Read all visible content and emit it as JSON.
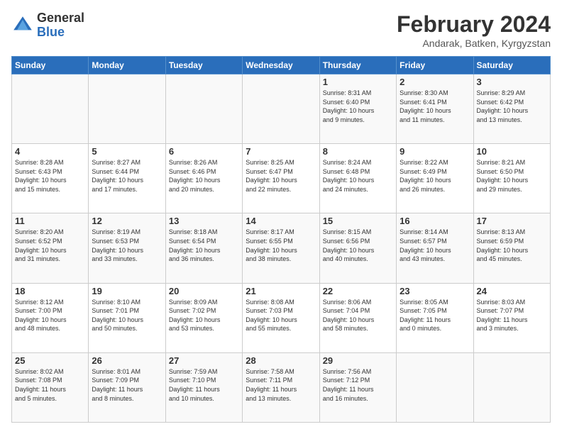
{
  "header": {
    "logo_general": "General",
    "logo_blue": "Blue",
    "month_year": "February 2024",
    "location": "Andarak, Batken, Kyrgyzstan"
  },
  "days_of_week": [
    "Sunday",
    "Monday",
    "Tuesday",
    "Wednesday",
    "Thursday",
    "Friday",
    "Saturday"
  ],
  "weeks": [
    [
      {
        "day": "",
        "info": ""
      },
      {
        "day": "",
        "info": ""
      },
      {
        "day": "",
        "info": ""
      },
      {
        "day": "",
        "info": ""
      },
      {
        "day": "1",
        "info": "Sunrise: 8:31 AM\nSunset: 6:40 PM\nDaylight: 10 hours\nand 9 minutes."
      },
      {
        "day": "2",
        "info": "Sunrise: 8:30 AM\nSunset: 6:41 PM\nDaylight: 10 hours\nand 11 minutes."
      },
      {
        "day": "3",
        "info": "Sunrise: 8:29 AM\nSunset: 6:42 PM\nDaylight: 10 hours\nand 13 minutes."
      }
    ],
    [
      {
        "day": "4",
        "info": "Sunrise: 8:28 AM\nSunset: 6:43 PM\nDaylight: 10 hours\nand 15 minutes."
      },
      {
        "day": "5",
        "info": "Sunrise: 8:27 AM\nSunset: 6:44 PM\nDaylight: 10 hours\nand 17 minutes."
      },
      {
        "day": "6",
        "info": "Sunrise: 8:26 AM\nSunset: 6:46 PM\nDaylight: 10 hours\nand 20 minutes."
      },
      {
        "day": "7",
        "info": "Sunrise: 8:25 AM\nSunset: 6:47 PM\nDaylight: 10 hours\nand 22 minutes."
      },
      {
        "day": "8",
        "info": "Sunrise: 8:24 AM\nSunset: 6:48 PM\nDaylight: 10 hours\nand 24 minutes."
      },
      {
        "day": "9",
        "info": "Sunrise: 8:22 AM\nSunset: 6:49 PM\nDaylight: 10 hours\nand 26 minutes."
      },
      {
        "day": "10",
        "info": "Sunrise: 8:21 AM\nSunset: 6:50 PM\nDaylight: 10 hours\nand 29 minutes."
      }
    ],
    [
      {
        "day": "11",
        "info": "Sunrise: 8:20 AM\nSunset: 6:52 PM\nDaylight: 10 hours\nand 31 minutes."
      },
      {
        "day": "12",
        "info": "Sunrise: 8:19 AM\nSunset: 6:53 PM\nDaylight: 10 hours\nand 33 minutes."
      },
      {
        "day": "13",
        "info": "Sunrise: 8:18 AM\nSunset: 6:54 PM\nDaylight: 10 hours\nand 36 minutes."
      },
      {
        "day": "14",
        "info": "Sunrise: 8:17 AM\nSunset: 6:55 PM\nDaylight: 10 hours\nand 38 minutes."
      },
      {
        "day": "15",
        "info": "Sunrise: 8:15 AM\nSunset: 6:56 PM\nDaylight: 10 hours\nand 40 minutes."
      },
      {
        "day": "16",
        "info": "Sunrise: 8:14 AM\nSunset: 6:57 PM\nDaylight: 10 hours\nand 43 minutes."
      },
      {
        "day": "17",
        "info": "Sunrise: 8:13 AM\nSunset: 6:59 PM\nDaylight: 10 hours\nand 45 minutes."
      }
    ],
    [
      {
        "day": "18",
        "info": "Sunrise: 8:12 AM\nSunset: 7:00 PM\nDaylight: 10 hours\nand 48 minutes."
      },
      {
        "day": "19",
        "info": "Sunrise: 8:10 AM\nSunset: 7:01 PM\nDaylight: 10 hours\nand 50 minutes."
      },
      {
        "day": "20",
        "info": "Sunrise: 8:09 AM\nSunset: 7:02 PM\nDaylight: 10 hours\nand 53 minutes."
      },
      {
        "day": "21",
        "info": "Sunrise: 8:08 AM\nSunset: 7:03 PM\nDaylight: 10 hours\nand 55 minutes."
      },
      {
        "day": "22",
        "info": "Sunrise: 8:06 AM\nSunset: 7:04 PM\nDaylight: 10 hours\nand 58 minutes."
      },
      {
        "day": "23",
        "info": "Sunrise: 8:05 AM\nSunset: 7:05 PM\nDaylight: 11 hours\nand 0 minutes."
      },
      {
        "day": "24",
        "info": "Sunrise: 8:03 AM\nSunset: 7:07 PM\nDaylight: 11 hours\nand 3 minutes."
      }
    ],
    [
      {
        "day": "25",
        "info": "Sunrise: 8:02 AM\nSunset: 7:08 PM\nDaylight: 11 hours\nand 5 minutes."
      },
      {
        "day": "26",
        "info": "Sunrise: 8:01 AM\nSunset: 7:09 PM\nDaylight: 11 hours\nand 8 minutes."
      },
      {
        "day": "27",
        "info": "Sunrise: 7:59 AM\nSunset: 7:10 PM\nDaylight: 11 hours\nand 10 minutes."
      },
      {
        "day": "28",
        "info": "Sunrise: 7:58 AM\nSunset: 7:11 PM\nDaylight: 11 hours\nand 13 minutes."
      },
      {
        "day": "29",
        "info": "Sunrise: 7:56 AM\nSunset: 7:12 PM\nDaylight: 11 hours\nand 16 minutes."
      },
      {
        "day": "",
        "info": ""
      },
      {
        "day": "",
        "info": ""
      }
    ]
  ]
}
